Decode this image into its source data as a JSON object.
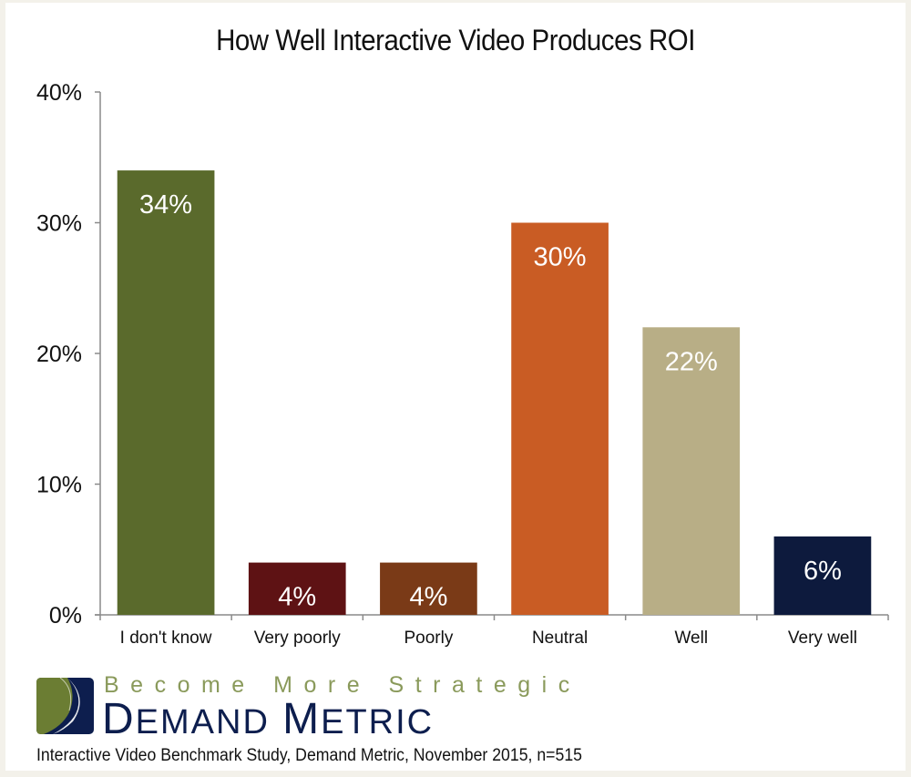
{
  "chart_data": {
    "type": "bar",
    "title": "How Well Interactive Video Produces ROI",
    "xlabel": "",
    "ylabel": "",
    "categories": [
      "I don't know",
      "Very poorly",
      "Poorly",
      "Neutral",
      "Well",
      "Very well"
    ],
    "values": [
      34,
      4,
      4,
      30,
      22,
      6
    ],
    "data_labels": [
      "34%",
      "4%",
      "4%",
      "30%",
      "22%",
      "6%"
    ],
    "colors": [
      "#5a6a2c",
      "#5e1214",
      "#7a3a17",
      "#c95c24",
      "#b8ae86",
      "#0d1a3d"
    ],
    "ylim": [
      0,
      40
    ],
    "yticks": [
      0,
      10,
      20,
      30,
      40
    ],
    "ytick_labels": [
      "0%",
      "10%",
      "20%",
      "30%",
      "40%"
    ],
    "grid": false,
    "legend": "none"
  },
  "branding": {
    "tagline": "Become More Strategic",
    "brand_name_first": "Demand",
    "brand_name_second": "Metric",
    "logo_icon": "demand-metric-logo-icon",
    "colors": {
      "navy": "#0d1e4e",
      "olive": "#8a9a5b"
    }
  },
  "source_note": "Interactive Video Benchmark Study, Demand Metric, November 2015, n=515"
}
